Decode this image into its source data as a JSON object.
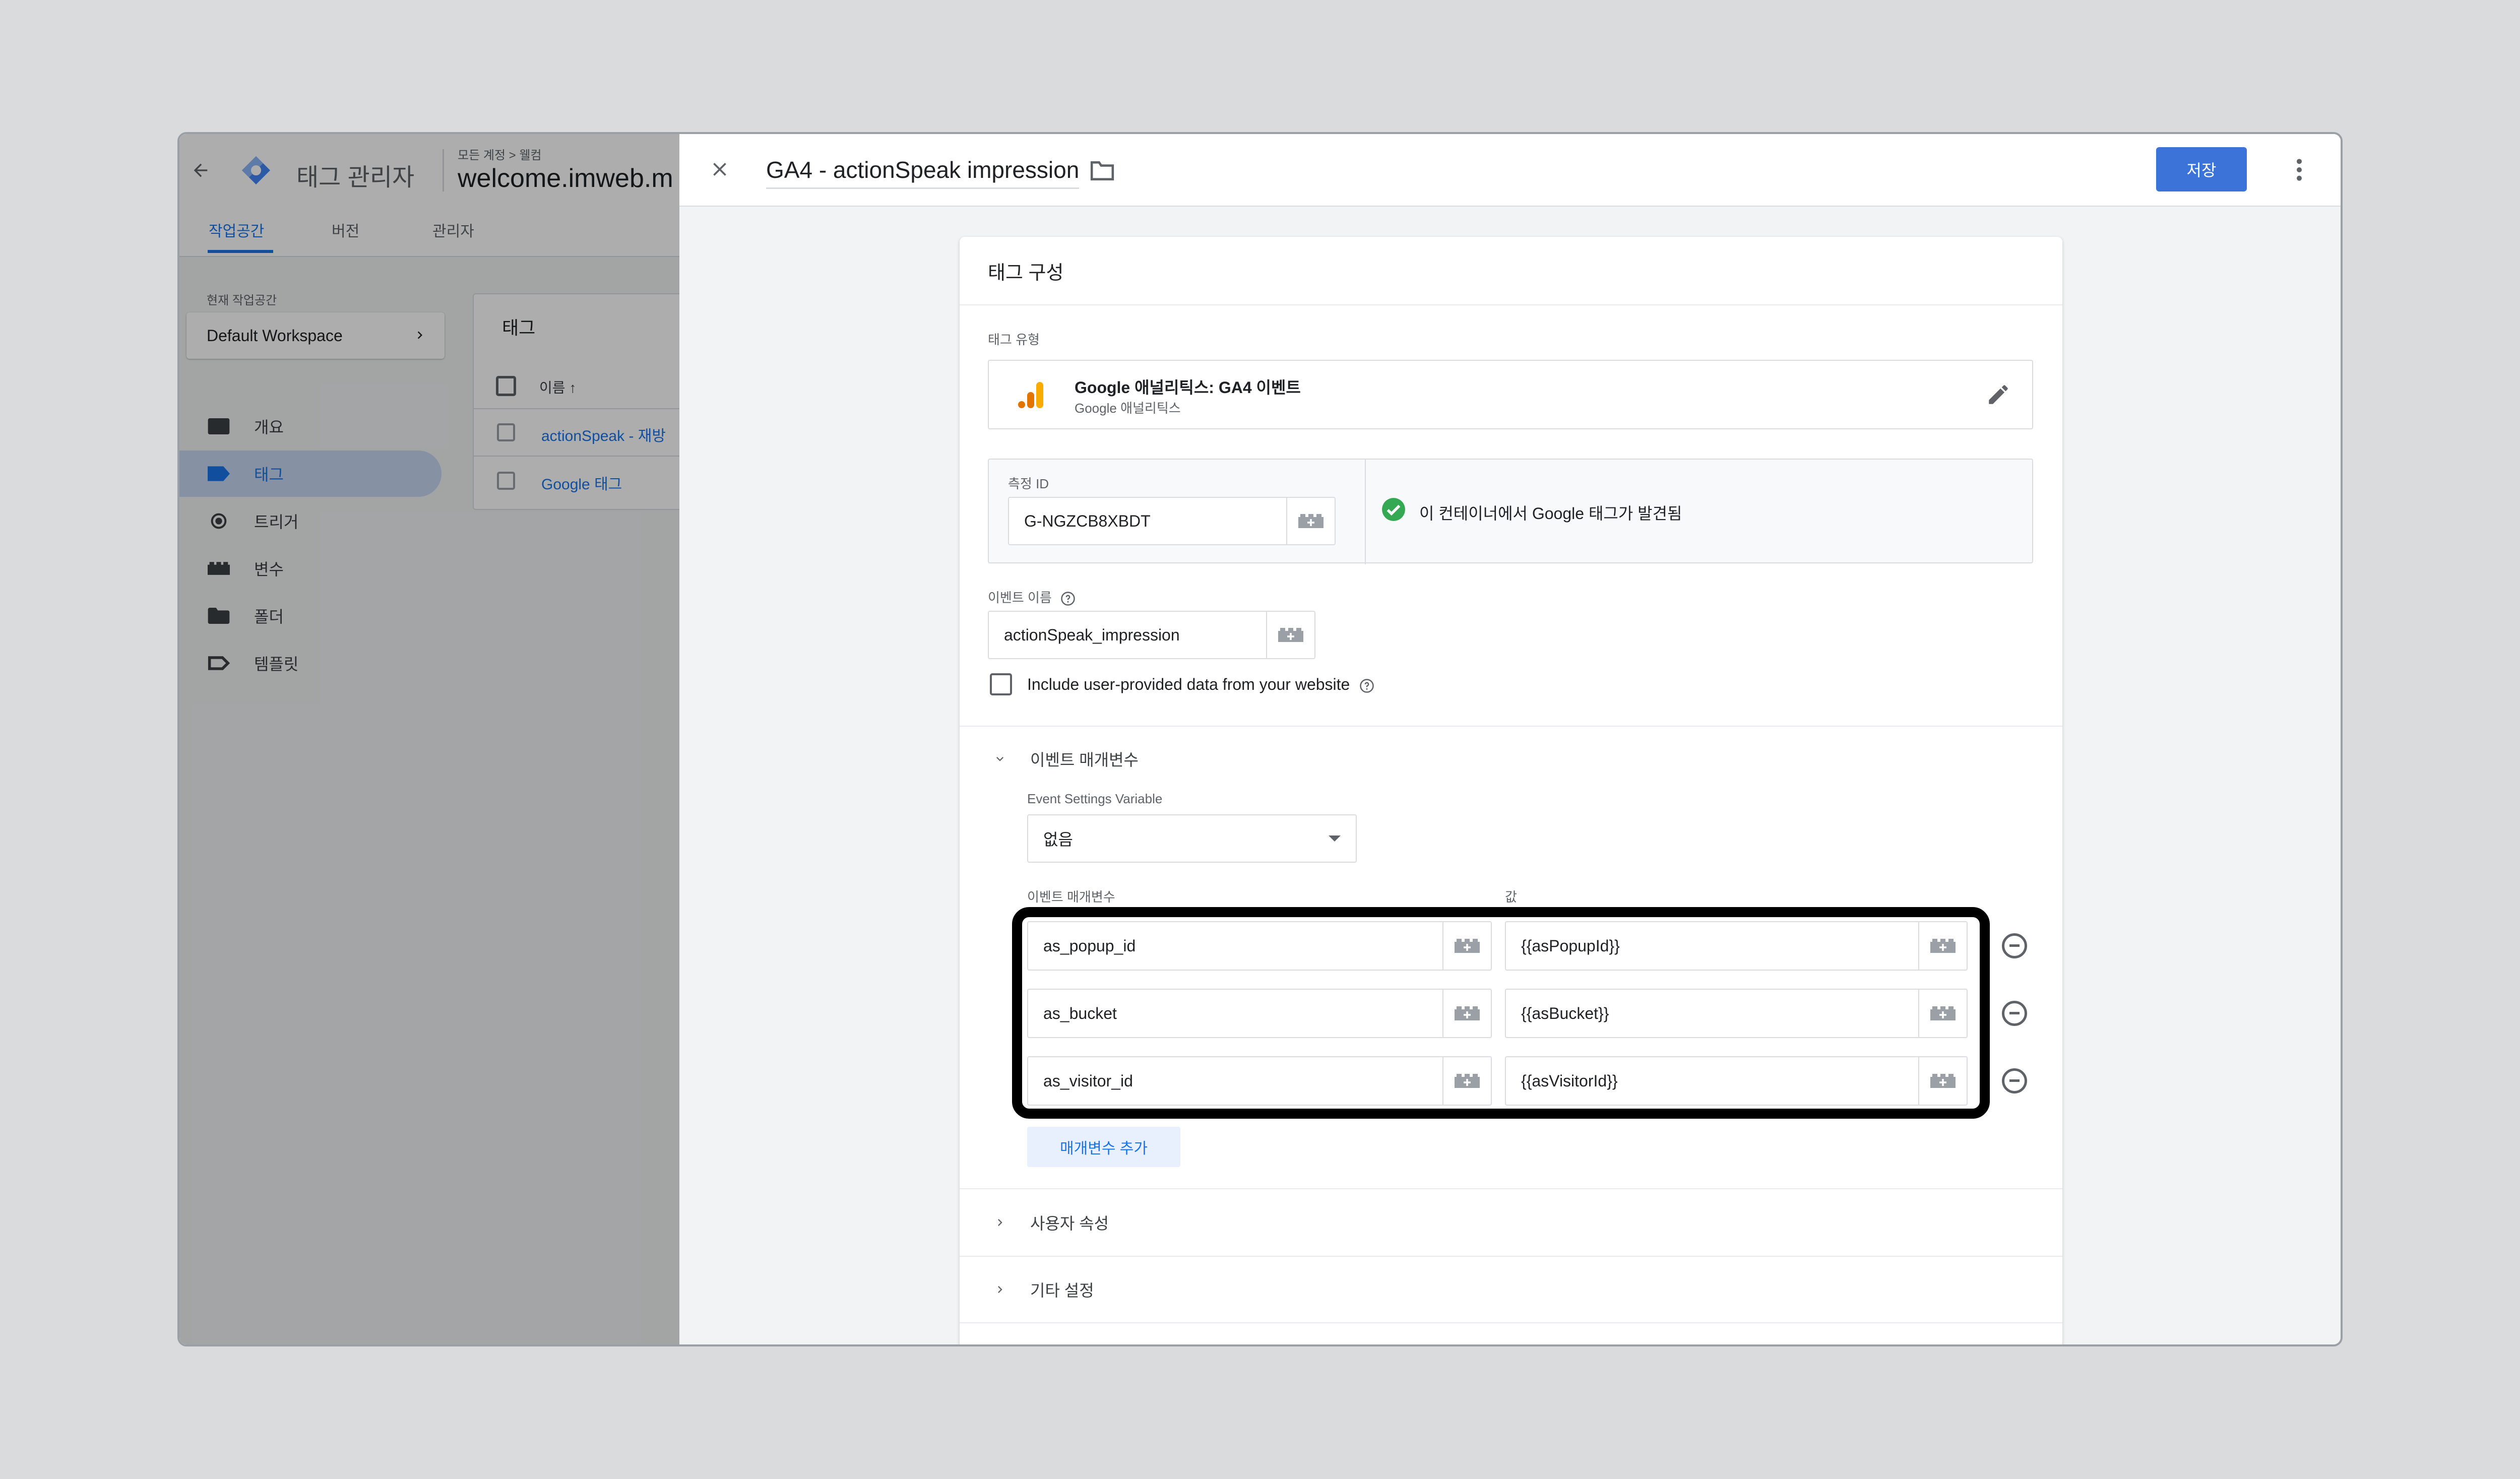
{
  "bg": {
    "app_title": "태그 관리자",
    "breadcrumb": "모든 계정 > 웰컴",
    "container_name": "welcome.imweb.m",
    "tabs": [
      "작업공간",
      "버전",
      "관리자"
    ],
    "workspace_label": "현재 작업공간",
    "workspace_name": "Default Workspace",
    "nav": [
      "개요",
      "태그",
      "트리거",
      "변수",
      "폴더",
      "템플릿"
    ],
    "tags_card_title": "태그",
    "tags_col_name": "이름",
    "tag_rows": [
      "actionSpeak - 재방",
      "Google 태그"
    ]
  },
  "panel": {
    "title": "GA4 - actionSpeak impression",
    "save_label": "저장",
    "card_title": "태그 구성",
    "tag_type_label": "태그 유형",
    "tag_type_name": "Google 애널리틱스: GA4 이벤트",
    "tag_type_sub": "Google 애널리틱스",
    "measurement_id_label": "측정 ID",
    "measurement_id_value": "G-NGZCB8XBDT",
    "found_message": "이 컨테이너에서 Google 태그가 발견됨",
    "event_name_label": "이벤트 이름",
    "event_name_value": "actionSpeak_impression",
    "include_user_data_label": "Include user-provided data from your website",
    "event_params_section": "이벤트 매개변수",
    "event_settings_var_label": "Event Settings Variable",
    "event_settings_var_value": "없음",
    "param_col_label": "이벤트 매개변수",
    "value_col_label": "값",
    "params": [
      {
        "name": "as_popup_id",
        "value": "{{asPopupId}}"
      },
      {
        "name": "as_bucket",
        "value": "{{asBucket}}"
      },
      {
        "name": "as_visitor_id",
        "value": "{{asVisitorId}}"
      }
    ],
    "add_param_label": "매개변수 추가",
    "user_props_section": "사용자 속성",
    "other_settings_section": "기타 설정"
  },
  "colors": {
    "accent": "#1a73e8",
    "save_bg": "#3b73d9",
    "success": "#34a853",
    "ga_orange": "#f9ab00",
    "ga_dark_orange": "#e37400",
    "highlight_border": "#000000"
  }
}
